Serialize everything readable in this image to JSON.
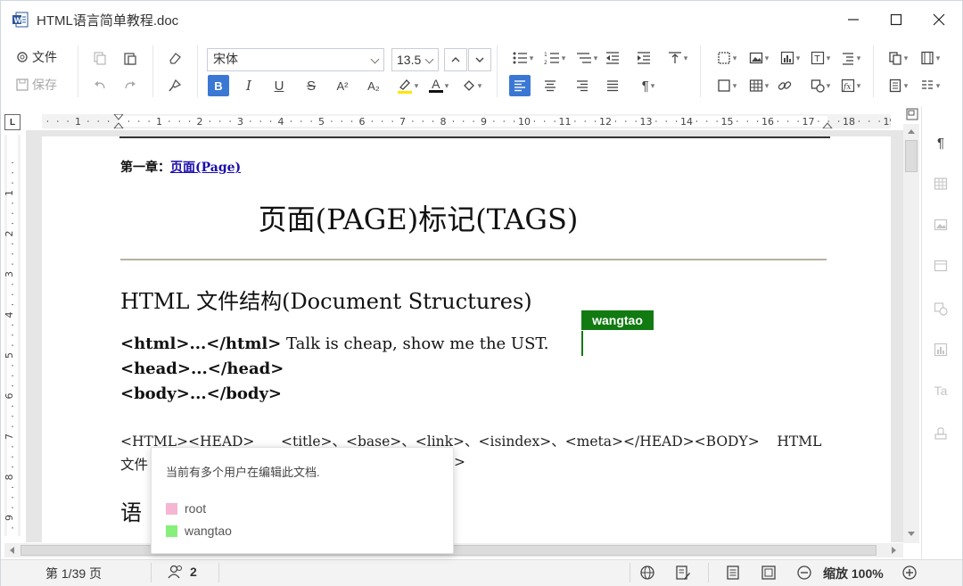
{
  "window": {
    "title": "HTML语言简单教程.doc"
  },
  "ribbon": {
    "file_label": "文件",
    "save_label": "保存",
    "font_name": "宋体",
    "font_size": "13.5",
    "bold_label": "B",
    "italic_label": "I",
    "underline_label": "U",
    "strike_label": "S",
    "sup_label": "A²",
    "sub_label": "A₂",
    "font_color_label": "A",
    "para_label": "¶"
  },
  "document": {
    "chapter_prefix": "第一章：",
    "chapter_link": "页面(Page)",
    "heading1": "页面(PAGE)标记(TAGS)",
    "heading2": "HTML 文件结构(Document Structures)",
    "lines": [
      {
        "b1": "<html>",
        "m": "...",
        "b2": "</html>",
        "rest": " Talk is cheap, show me the UST."
      },
      {
        "b1": "<head>",
        "m": "...",
        "b2": "</head>",
        "rest": ""
      },
      {
        "b1": "<body>",
        "m": "...",
        "b2": "</body>",
        "rest": ""
      }
    ],
    "para_line1": "<HTML><HEAD>      <title>、<base>、<link>、<isindex>、<meta></HEAD><BODY>    HTML",
    "para_line2_start": "文件",
    "para_line2_end": ">",
    "heading2_partial": "语",
    "cursor_user": "wangtao"
  },
  "users_popup": {
    "title": "当前有多个用户在编辑此文档.",
    "users": [
      {
        "name": "root",
        "color": "#f4b6d2"
      },
      {
        "name": "wangtao",
        "color": "#86f07a"
      }
    ]
  },
  "status": {
    "page_indicator": "第 1/39 页",
    "user_count": "2",
    "zoom_label": "缩放 100%"
  },
  "colors": {
    "accent": "#3a78d4",
    "cursor_green": "#117a11",
    "link": "#1a0dab"
  }
}
